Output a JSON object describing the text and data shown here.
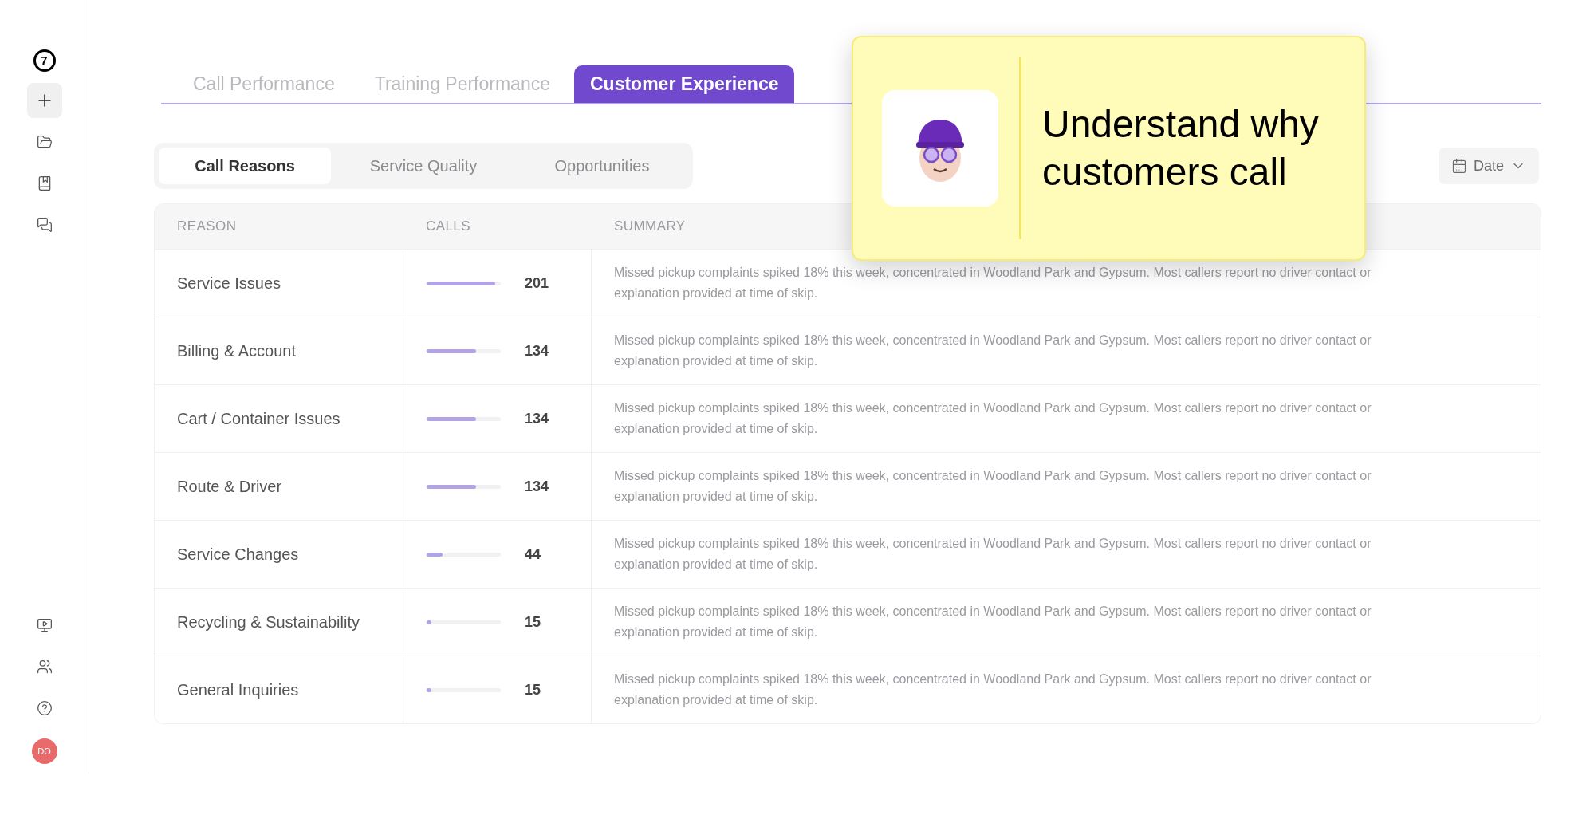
{
  "sidebar": {
    "logo": "7",
    "items": [
      {
        "kind": "plus",
        "selected": true
      },
      {
        "kind": "folder",
        "selected": false
      },
      {
        "kind": "book",
        "selected": false
      },
      {
        "kind": "chat",
        "selected": false
      }
    ],
    "bottom_items": [
      {
        "kind": "video"
      },
      {
        "kind": "people"
      },
      {
        "kind": "help"
      }
    ],
    "avatar": {
      "initials": "DO",
      "color": "#e86a6a"
    }
  },
  "tabs": [
    {
      "label": "Call Performance",
      "selected": false
    },
    {
      "label": "Training Performance",
      "selected": false
    },
    {
      "label": "Customer Experience",
      "selected": true
    }
  ],
  "subtabs": [
    {
      "label": "Call Reasons",
      "selected": true
    },
    {
      "label": "Service Quality",
      "selected": false
    },
    {
      "label": "Opportunities",
      "selected": false
    }
  ],
  "date_filter": {
    "label": "Date"
  },
  "callout": {
    "text": "Understand why customers call"
  },
  "table": {
    "columns": [
      "REASON",
      "CALLS",
      "SUMMARY"
    ],
    "rows": [
      {
        "reason": "Service Issues",
        "level": 0.93,
        "calls": "201",
        "summary": "Missed pickup complaints spiked 18% this week, concentrated in Woodland Park and Gypsum. Most callers report no driver contact or explanation provided at time of skip."
      },
      {
        "reason": "Billing & Account",
        "level": 0.67,
        "calls": "134",
        "summary": "Missed pickup complaints spiked 18% this week, concentrated in Woodland Park and Gypsum. Most callers report no driver contact or explanation provided at time of skip."
      },
      {
        "reason": "Cart / Container Issues",
        "level": 0.67,
        "calls": "134",
        "summary": "Missed pickup complaints spiked 18% this week, concentrated in Woodland Park and Gypsum. Most callers report no driver contact or explanation provided at time of skip."
      },
      {
        "reason": "Route & Driver",
        "level": 0.67,
        "calls": "134",
        "summary": "Missed pickup complaints spiked 18% this week, concentrated in Woodland Park and Gypsum. Most callers report no driver contact or explanation provided at time of skip."
      },
      {
        "reason": "Service Changes",
        "level": 0.22,
        "calls": "44",
        "summary": "Missed pickup complaints spiked 18% this week, concentrated in Woodland Park and Gypsum. Most callers report no driver contact or explanation provided at time of skip."
      },
      {
        "reason": "Recycling & Sustainability",
        "level": 0.06,
        "calls": "15",
        "summary": "Missed pickup complaints spiked 18% this week, concentrated in Woodland Park and Gypsum. Most callers report no driver contact or explanation provided at time of skip."
      },
      {
        "reason": "General Inquiries",
        "level": 0.06,
        "calls": "15",
        "summary": "Missed pickup complaints spiked 18% this week, concentrated in Woodland Park and Gypsum. Most callers report no driver contact or explanation provided at time of skip."
      }
    ]
  }
}
